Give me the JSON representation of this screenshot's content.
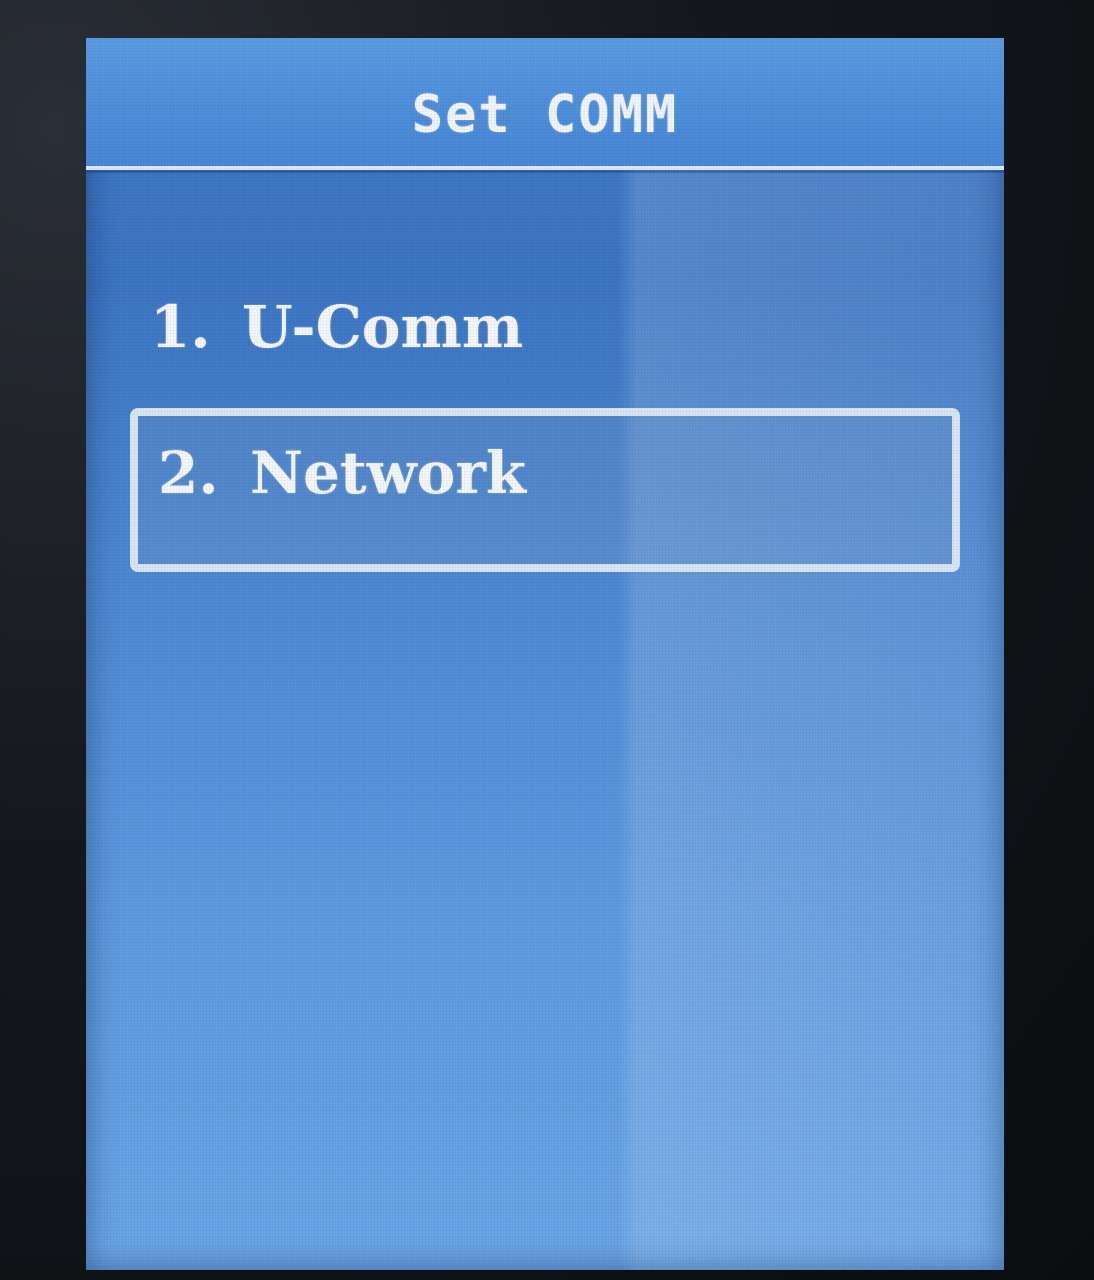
{
  "screen": {
    "title": "Set COMM"
  },
  "menu": {
    "items": [
      {
        "number": "1.",
        "label": "U-Comm",
        "selected": false
      },
      {
        "number": "2.",
        "label": "Network",
        "selected": true
      }
    ]
  },
  "colors": {
    "screen_background": "#4f8ad4",
    "header_background": "#5d9be3",
    "text": "#f4f7fb",
    "selection_border": "#d9e6f5"
  }
}
